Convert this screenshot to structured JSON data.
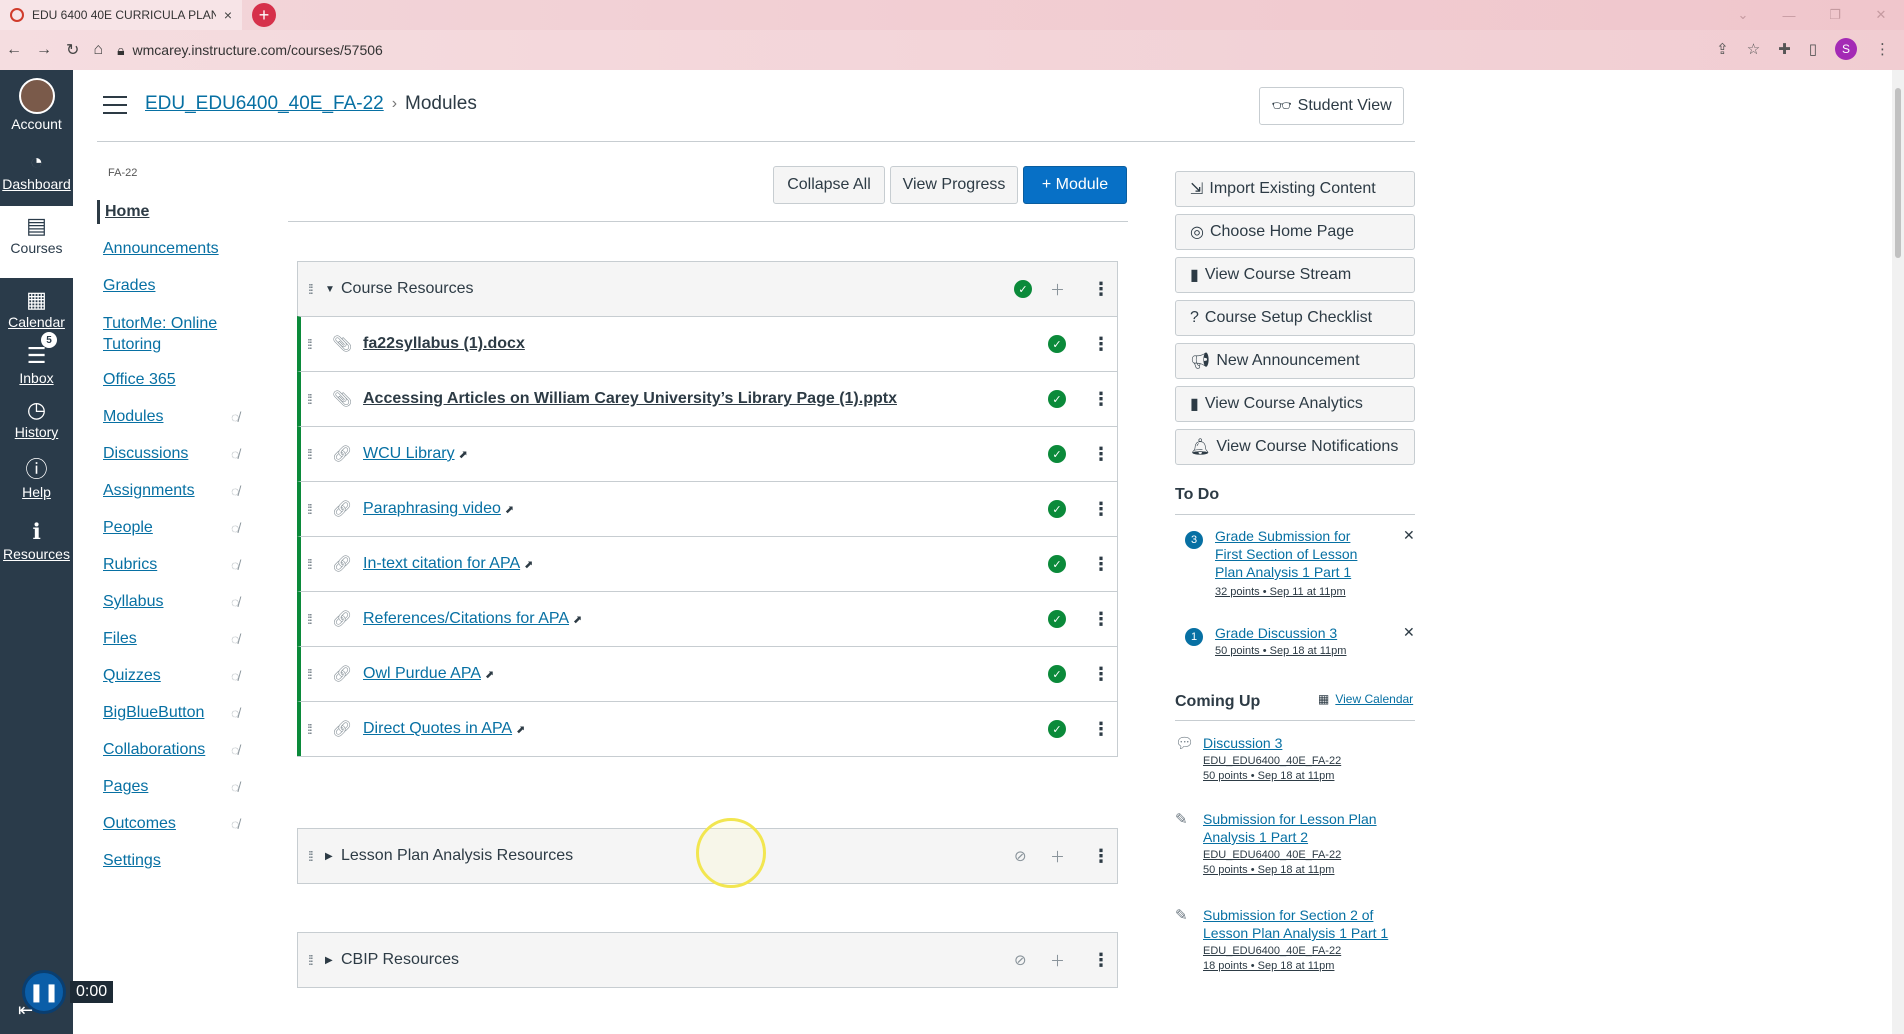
{
  "browser": {
    "tab_title": "EDU 6400 40E CURRICULA PLAN",
    "tab_close": "×",
    "new_tab": "+",
    "url": "wmcarey.instructure.com/courses/57506",
    "profile_initial": "S"
  },
  "global_nav": {
    "items": [
      {
        "label": "Account",
        "icon": "avatar"
      },
      {
        "label": "Dashboard",
        "icon": "dashboard-icon"
      },
      {
        "label": "Courses",
        "icon": "courses-icon"
      },
      {
        "label": "Calendar",
        "icon": "calendar-icon"
      },
      {
        "label": "Inbox",
        "icon": "inbox-icon",
        "badge": "5"
      },
      {
        "label": "History",
        "icon": "history-icon"
      },
      {
        "label": "Help",
        "icon": "help-icon"
      },
      {
        "label": "Resources",
        "icon": "info-icon"
      }
    ],
    "player_time": "0:00"
  },
  "header": {
    "course_link": "EDU_EDU6400_40E_FA-22",
    "separator": "›",
    "current_page": "Modules",
    "student_view": "Student View"
  },
  "course_nav": {
    "term": "FA-22",
    "items": [
      {
        "label": "Home",
        "hidden": false
      },
      {
        "label": "Announcements",
        "hidden": false
      },
      {
        "label": "Grades",
        "hidden": false
      },
      {
        "label": "TutorMe: Online Tutoring",
        "hidden": false
      },
      {
        "label": "Office 365",
        "hidden": false
      },
      {
        "label": "Modules",
        "hidden": true
      },
      {
        "label": "Discussions",
        "hidden": true
      },
      {
        "label": "Assignments",
        "hidden": true
      },
      {
        "label": "People",
        "hidden": true
      },
      {
        "label": "Rubrics",
        "hidden": true
      },
      {
        "label": "Syllabus",
        "hidden": true
      },
      {
        "label": "Files",
        "hidden": true
      },
      {
        "label": "Quizzes",
        "hidden": true
      },
      {
        "label": "BigBlueButton",
        "hidden": true
      },
      {
        "label": "Collaborations",
        "hidden": true
      },
      {
        "label": "Pages",
        "hidden": true
      },
      {
        "label": "Outcomes",
        "hidden": true
      },
      {
        "label": "Settings",
        "hidden": false
      }
    ]
  },
  "toolbar": {
    "collapse_all": "Collapse All",
    "view_progress": "View Progress",
    "add_module": "+ Module"
  },
  "modules": [
    {
      "title": "Course Resources",
      "published": true,
      "expanded": true,
      "items": [
        {
          "title": "fa22syllabus (1).docx",
          "type": "attachment"
        },
        {
          "title": "Accessing Articles on William Carey University’s Library Page (1).pptx",
          "type": "attachment"
        },
        {
          "title": "WCU Library",
          "type": "external-link"
        },
        {
          "title": "Paraphrasing video",
          "type": "external-link"
        },
        {
          "title": "In-text citation for APA",
          "type": "external-link"
        },
        {
          "title": "References/Citations for APA",
          "type": "external-link"
        },
        {
          "title": "Owl Purdue APA",
          "type": "external-link"
        },
        {
          "title": "Direct Quotes in APA",
          "type": "external-link"
        }
      ]
    },
    {
      "title": "Lesson Plan Analysis Resources",
      "published": false,
      "expanded": false
    },
    {
      "title": "CBIP Resources",
      "published": false,
      "expanded": false
    }
  ],
  "sidebar": {
    "actions": [
      "Import Existing Content",
      "Choose Home Page",
      "View Course Stream",
      "Course Setup Checklist",
      "New Announcement",
      "View Course Analytics",
      "View Course Notifications"
    ],
    "todo_heading": "To Do",
    "todo": [
      {
        "count": "3",
        "title": "Grade Submission for First Section of Lesson Plan Analysis 1 Part 1",
        "meta": "32 points • Sep 11 at 11pm"
      },
      {
        "count": "1",
        "title": "Grade Discussion 3",
        "meta": "50 points • Sep 18 at 11pm"
      }
    ],
    "coming_up_heading": "Coming Up",
    "view_calendar": "View Calendar",
    "coming_up": [
      {
        "icon": "discussion-icon",
        "title": "Discussion 3",
        "course": "EDU_EDU6400_40E_FA-22",
        "meta": "50 points • Sep 18 at 11pm"
      },
      {
        "icon": "assignment-icon",
        "title": "Submission for Lesson Plan Analysis 1 Part 2",
        "course": "EDU_EDU6400_40E_FA-22",
        "meta": "50 points • Sep 18 at 11pm"
      },
      {
        "icon": "assignment-icon",
        "title": "Submission for Section 2 of Lesson Plan Analysis 1 Part 1",
        "course": "EDU_EDU6400_40E_FA-22",
        "meta": "18 points • Sep 18 at 11pm"
      }
    ]
  }
}
